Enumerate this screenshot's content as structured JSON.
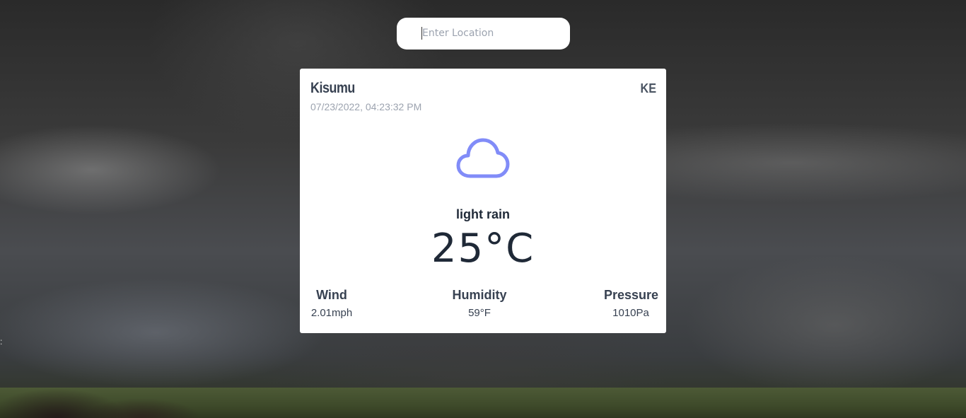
{
  "search": {
    "placeholder": "Enter Location",
    "value": ""
  },
  "weather": {
    "city": "Kisumu",
    "country": "KE",
    "datetime": "07/23/2022, 04:23:32 PM",
    "icon": "cloud-icon",
    "description": "light rain",
    "temperature": "25°C",
    "wind_label": "Wind",
    "wind_value": "2.01mph",
    "humidity_label": "Humidity",
    "humidity_value": "59°F",
    "pressure_label": "Pressure",
    "pressure_value": "1010Pa"
  },
  "colors": {
    "icon": "#818cf8",
    "card_bg": "#ffffff",
    "text_dark": "#1f2937"
  }
}
